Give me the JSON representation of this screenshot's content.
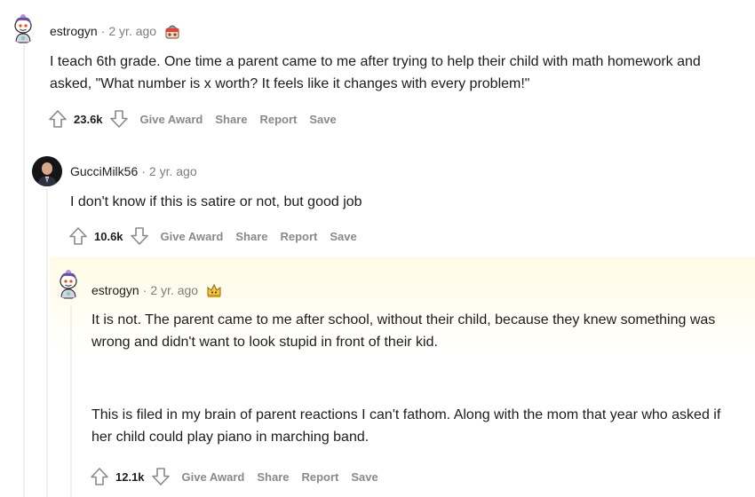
{
  "comments": [
    {
      "username": "estrogyn",
      "separator": "·",
      "time": "2 yr. ago",
      "award_icon": "award-badge-icon",
      "body": [
        "I teach 6th grade. One time a parent came to me after trying to help their child with math homework and asked, \"What number is x worth? It feels like it changes with every problem!\""
      ],
      "score": "23.6k",
      "actions": {
        "give_award": "Give Award",
        "share": "Share",
        "report": "Report",
        "save": "Save"
      }
    },
    {
      "username": "GucciMilk56",
      "separator": "·",
      "time": "2 yr. ago",
      "body": [
        "I don't know if this is satire or not, but good job"
      ],
      "score": "10.6k",
      "actions": {
        "give_award": "Give Award",
        "share": "Share",
        "report": "Report",
        "save": "Save"
      }
    },
    {
      "username": "estrogyn",
      "separator": "·",
      "time": "2 yr. ago",
      "award_icon": "op-crown-badge-icon",
      "body": [
        "It is not. The parent came to me after school, without their child, because they knew something was wrong and didn't want to look stupid in front of their kid.",
        "This is filed in my brain of parent reactions I can't fathom. Along with the mom that year who asked if her child could play piano in marching band."
      ],
      "score": "12.1k",
      "actions": {
        "give_award": "Give Award",
        "share": "Share",
        "report": "Report",
        "save": "Save"
      }
    }
  ],
  "colors": {
    "text": "#1c1c1c",
    "meta": "#7c7c7c",
    "action": "#878a8c",
    "thread_line": "#edeff1",
    "highlight": "#fffbe6"
  }
}
